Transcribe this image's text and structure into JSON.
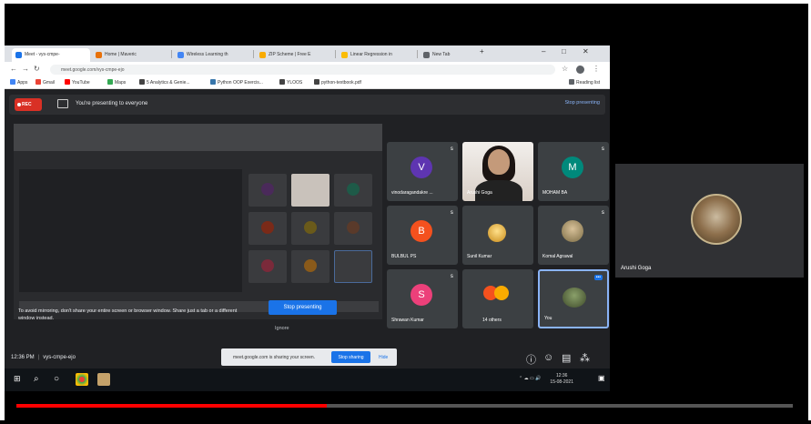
{
  "browser": {
    "tabs": [
      {
        "label": "Meet - vys-cmpe-",
        "color": "#1a73e8"
      },
      {
        "label": "Home | Maveric",
        "color": "#e8710a"
      },
      {
        "label": "Wireless Learning th",
        "color": "#4285f4"
      },
      {
        "label": "ZIP Scheme | Free E",
        "color": "#f9ab00"
      },
      {
        "label": "Linear Regression in",
        "color": "#fbbc04"
      },
      {
        "label": "New Tab",
        "color": "#5f6368"
      }
    ],
    "address": "meet.google.com/vys-cmpe-ejo",
    "bookmarks": [
      {
        "label": "Apps",
        "color": "#4285f4"
      },
      {
        "label": "Gmail",
        "color": "#ea4335"
      },
      {
        "label": "YouTube",
        "color": "#ff0000"
      },
      {
        "label": "Maps",
        "color": "#34a853"
      },
      {
        "label": "5 Analytics & Genie...",
        "color": "#444"
      },
      {
        "label": "Python OOP Exercis...",
        "color": "#3776ab"
      },
      {
        "label": "YLOOS",
        "color": "#444"
      },
      {
        "label": "python-textbook.pdf",
        "color": "#444"
      }
    ],
    "reading_list": "Reading list"
  },
  "meet": {
    "rec_label": "REC",
    "presenting_text": "You're presenting to everyone",
    "stop_presenting_small": "Stop presenting",
    "warning_text": "To avoid mirroring, don't share your entire screen or browser window. Share just a tab or a different window instead.",
    "stop_presenting_button": "Stop presenting",
    "ignore_label": "Ignore",
    "tiles": [
      {
        "name": "vinodaragandakre ...",
        "initial": "V",
        "color": "#5e35b1"
      },
      {
        "name": "Arushi Goga",
        "initial": "",
        "color": ""
      },
      {
        "name": "MOHAM BA",
        "initial": "M",
        "color": "#00897b"
      },
      {
        "name": "BULBUL PS",
        "initial": "B",
        "color": "#f4511e"
      },
      {
        "name": "Sunil Kumar",
        "initial": "",
        "color": ""
      },
      {
        "name": "Komal Agrawal",
        "initial": "",
        "color": ""
      },
      {
        "name": "Shrawan Kumar",
        "initial": "S",
        "color": "#ec407a"
      },
      {
        "name": "14 others",
        "initial": "",
        "color": ""
      },
      {
        "name": "You",
        "initial": "",
        "color": ""
      }
    ],
    "time": "12:36 PM",
    "meeting_code": "vys-cmpe-ejo",
    "sharing_text": "meet.google.com is sharing your screen.",
    "stop_sharing": "Stop sharing",
    "hide": "Hide"
  },
  "taskbar": {
    "clock_time": "12:36",
    "clock_date": "15-08-2021"
  },
  "right_tile": {
    "name": "Arushi Goga"
  },
  "video": {
    "progress": 0.4
  }
}
